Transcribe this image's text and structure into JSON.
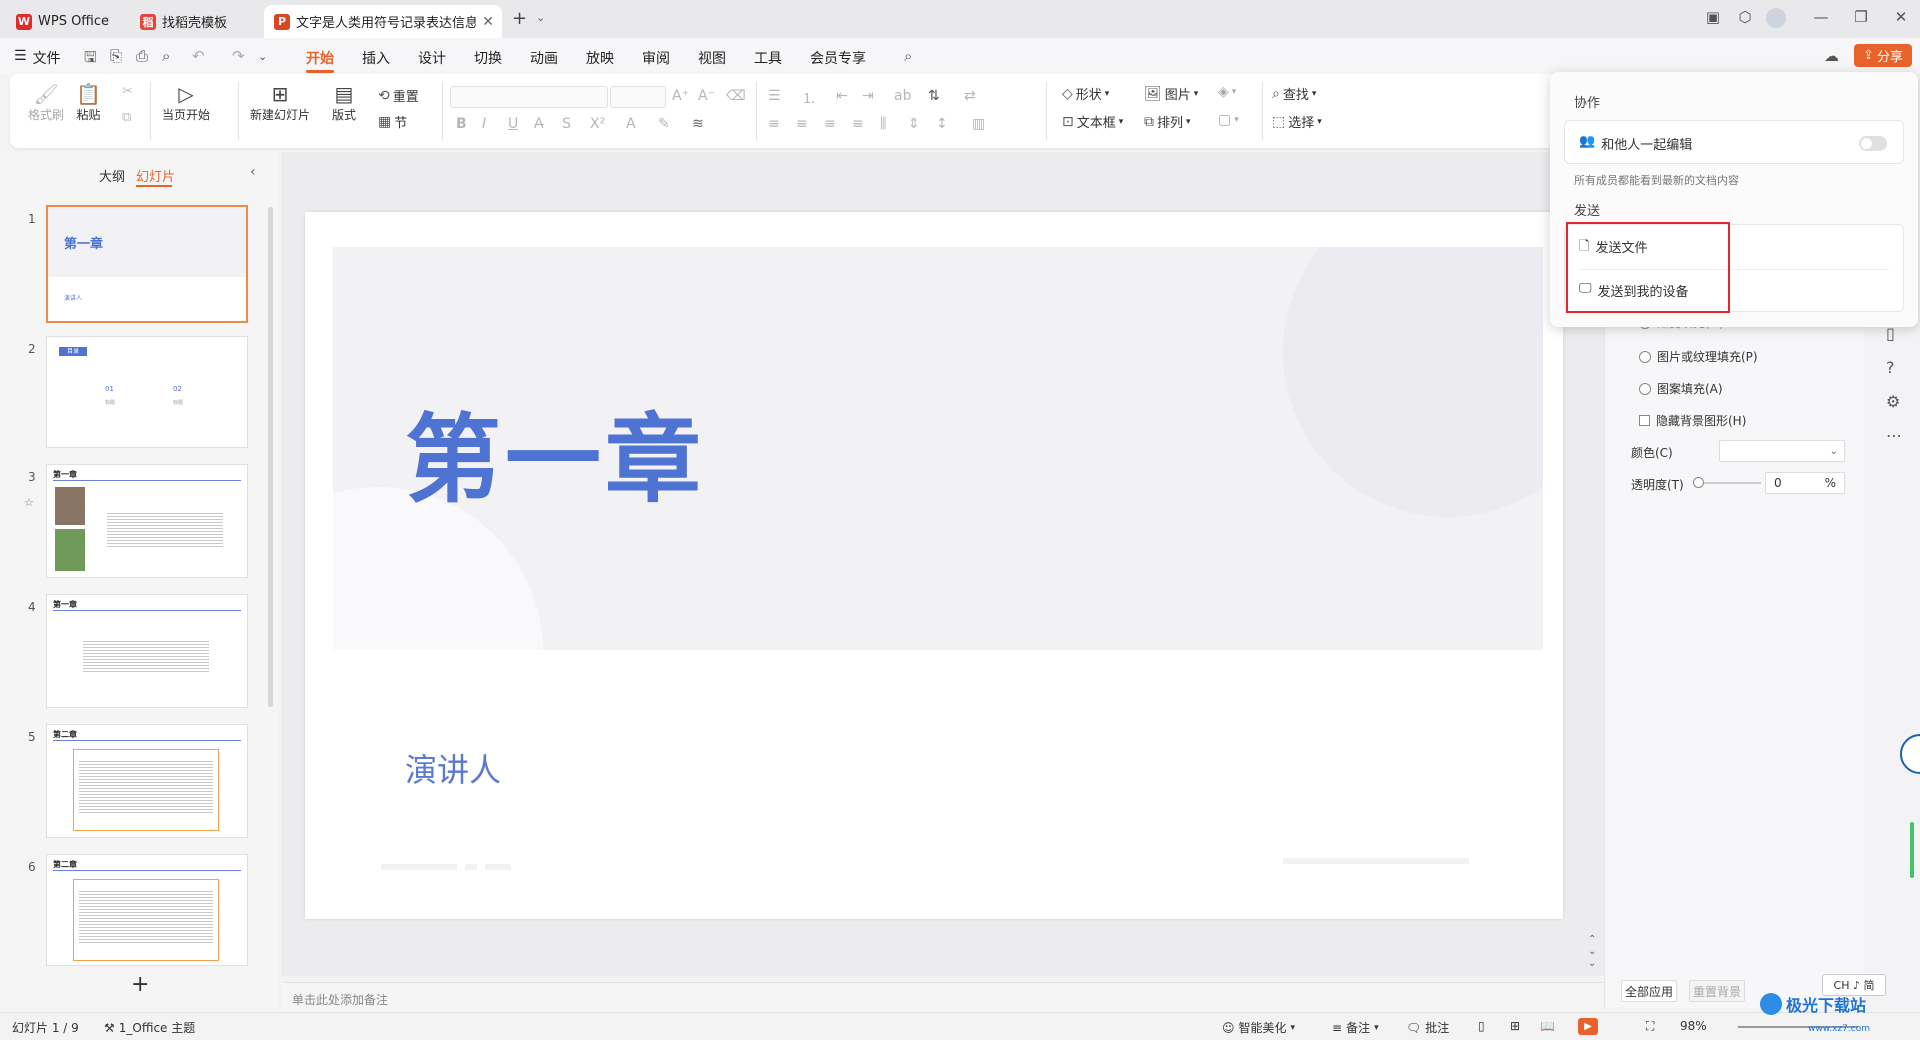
{
  "tabs": [
    {
      "label": "WPS Office"
    },
    {
      "label": "找稻壳模板"
    },
    {
      "label": "文字是人类用符号记录表达信息以"
    }
  ],
  "menu": {
    "file": "文件",
    "items": [
      "开始",
      "插入",
      "设计",
      "切换",
      "动画",
      "放映",
      "审阅",
      "视图",
      "工具",
      "会员专享"
    ],
    "active": "开始",
    "share": "分享"
  },
  "ribbon": {
    "format_painter": "格式刷",
    "paste": "粘贴",
    "start_from_current": "当页开始",
    "new_slide": "新建幻灯片",
    "layout": "版式",
    "reset": "重置",
    "section": "节",
    "shape": "形状",
    "image": "图片",
    "textbox": "文本框",
    "arrange": "排列",
    "find": "查找",
    "select": "选择"
  },
  "left_panel": {
    "tab_outline": "大纲",
    "tab_slides": "幻灯片",
    "slides": [
      {
        "num": "1",
        "title": "第一章",
        "sub": "演讲人"
      },
      {
        "num": "2",
        "title": "目录",
        "items": [
          "01",
          "02"
        ],
        "sublabel": "标题"
      },
      {
        "num": "3",
        "title": "第一章"
      },
      {
        "num": "4",
        "title": "第一章"
      },
      {
        "num": "5",
        "title": "第二章"
      },
      {
        "num": "6",
        "title": "第二章"
      }
    ],
    "add": "+"
  },
  "slide": {
    "title": "第一章",
    "subtitle": "演讲人"
  },
  "notes_placeholder": "单击此处添加备注",
  "popup": {
    "collab_header": "协作",
    "collab_edit": "和他人一起编辑",
    "collab_desc": "所有成员都能看到最新的文档内容",
    "send_header": "发送",
    "send_file": "发送文件",
    "send_device": "发送到我的设备"
  },
  "right_panel": {
    "partial_option": "渐变填充(G)",
    "options": [
      "图片或纹理填充(P)",
      "图案填充(A)"
    ],
    "hide_bg": "隐藏背景图形(H)",
    "color_label": "颜色(C)",
    "transparency_label": "透明度(T)",
    "transparency_value": "0",
    "transparency_unit": "%",
    "apply_all": "全部应用",
    "reset_bg": "重置背景"
  },
  "ime": "CH ♪ 简",
  "status": {
    "slide_counter": "幻灯片 1 / 9",
    "theme": "1_Office 主题",
    "beautify": "智能美化",
    "notes": "备注",
    "comments": "批注",
    "zoom": "98%"
  },
  "watermark": "极光下载站",
  "watermark_url": "www.xz7.com",
  "colors": {
    "accent": "#e8632a",
    "slide_title": "#4e73d2",
    "highlight_box": "#e8232b"
  }
}
